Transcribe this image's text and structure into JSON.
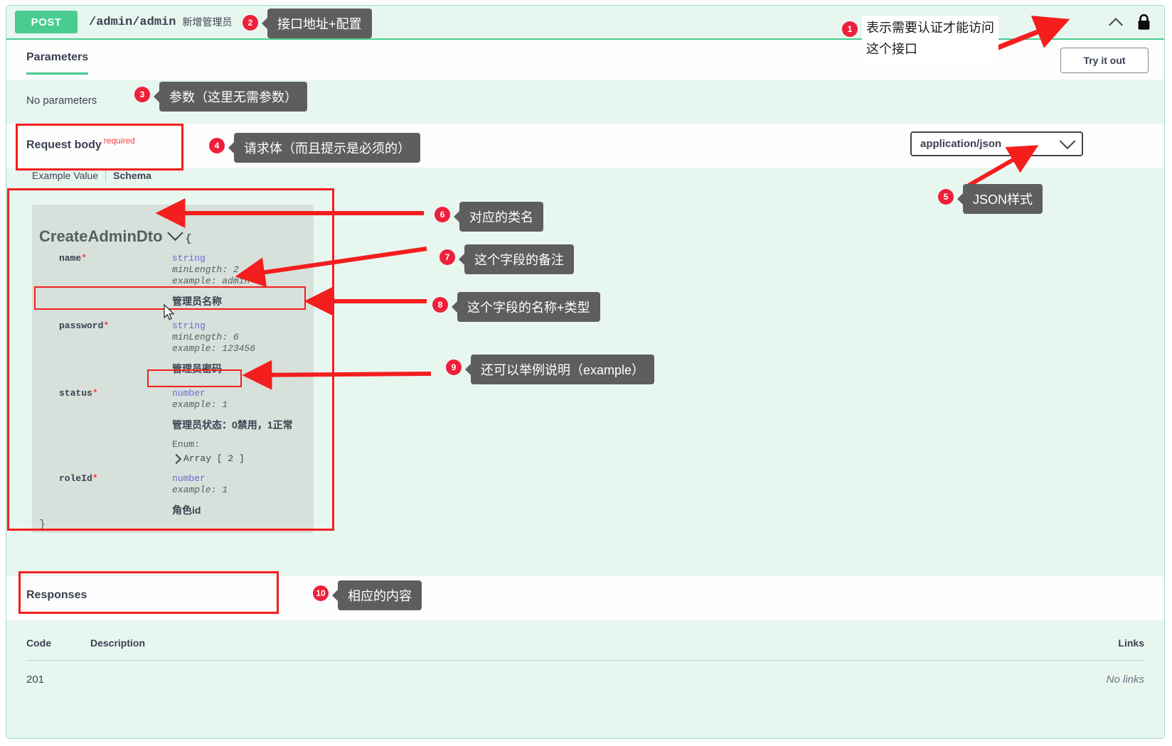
{
  "operation": {
    "method": "POST",
    "path": "/admin/admin",
    "summary": "新增管理员",
    "try_it_out_label": "Try it out",
    "lock_icon": "lock-icon",
    "collapse_icon": "chevron-up-icon"
  },
  "tabs": {
    "parameters_label": "Parameters"
  },
  "parameters": {
    "empty_text": "No parameters"
  },
  "request_body": {
    "title": "Request body",
    "required_label": "required",
    "mime_selected": "application/json"
  },
  "example_tabs": {
    "example_value": "Example Value",
    "schema": "Schema"
  },
  "schema": {
    "model_name": "CreateAdminDto",
    "open_brace": "{",
    "close_brace": "}",
    "properties": [
      {
        "name": "name",
        "required_marker": "*",
        "type": "string",
        "meta": [
          "minLength: 2",
          "example: admin"
        ],
        "note": "管理员名称"
      },
      {
        "name": "password",
        "required_marker": "*",
        "type": "string",
        "meta": [
          "minLength: 6",
          "example: 123456"
        ],
        "note": "管理员密码"
      },
      {
        "name": "status",
        "required_marker": "*",
        "type": "number",
        "meta": [
          "example: 1"
        ],
        "note": "管理员状态：0禁用，1正常",
        "enum_label": "Enum:",
        "enum_array": "Array [ 2 ]"
      },
      {
        "name": "roleId",
        "required_marker": "*",
        "type": "number",
        "meta": [
          "example: 1"
        ],
        "note": "角色id"
      }
    ]
  },
  "responses": {
    "title": "Responses",
    "columns": {
      "code": "Code",
      "description": "Description",
      "links": "Links"
    },
    "rows": [
      {
        "code": "201",
        "description": "",
        "links": "No links"
      }
    ]
  },
  "annotations": [
    {
      "num": "1",
      "text_line1": "表示需要认证才能访问",
      "text_line2": "这个接口",
      "style": "plain"
    },
    {
      "num": "2",
      "text": "接口地址+配置",
      "style": "bubble"
    },
    {
      "num": "3",
      "text": "参数（这里无需参数）",
      "style": "bubble"
    },
    {
      "num": "4",
      "text": "请求体（而且提示是必须的）",
      "style": "bubble"
    },
    {
      "num": "5",
      "text": "JSON样式",
      "style": "bubble"
    },
    {
      "num": "6",
      "text": "对应的类名",
      "style": "bubble"
    },
    {
      "num": "7",
      "text": "这个字段的备注",
      "style": "bubble"
    },
    {
      "num": "8",
      "text": "这个字段的名称+类型",
      "style": "bubble"
    },
    {
      "num": "9",
      "text": "还可以举例说明（example）",
      "style": "bubble"
    },
    {
      "num": "10",
      "text": "相应的内容",
      "style": "bubble"
    }
  ],
  "colors": {
    "post_green": "#49cc90",
    "band_green": "#e8f6f0",
    "schema_box": "#d7e0da",
    "required_red": "#f93e3e",
    "annotation_red": "#ee1f3a",
    "annotation_bubble": "#5e5e5e",
    "type_purple": "#6b6bd6"
  }
}
